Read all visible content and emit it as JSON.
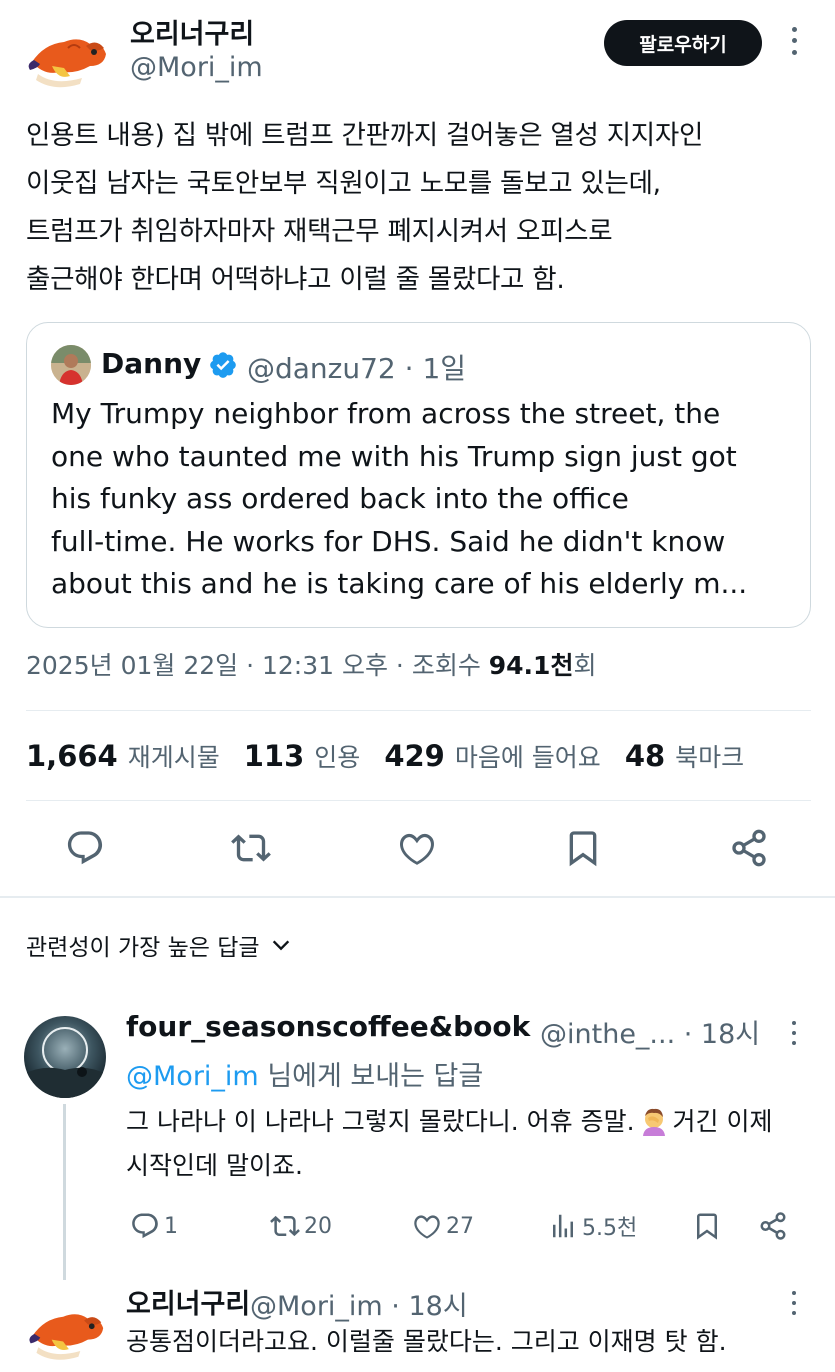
{
  "colors": {
    "text": "#0f1419",
    "secondary": "#536471",
    "link": "#1d9bf0",
    "border": "#cfd9de",
    "follow_bg": "#0f1419"
  },
  "author": {
    "display_name": "오리너구리",
    "handle": "@Mori_im",
    "avatar_icon": "duck-avatar-icon"
  },
  "follow_label": "팔로우하기",
  "tweet_lines": [
    "인용트 내용) 집 밖에 트럼프 간판까지 걸어놓은 열성 지지자인",
    "이웃집 남자는 국토안보부 직원이고 노모를 돌보고 있는데,",
    "트럼프가 취임하자마자 재택근무 폐지시켜서 오피스로",
    "출근해야 한다며 어떡하냐고 이럴 줄 몰랐다고 함."
  ],
  "quote": {
    "name": "Danny",
    "handle_time": "@danzu72 · 1일",
    "lines": [
      "My Trumpy neighbor from across the street, the",
      "one who taunted me with his Trump sign just got",
      "his funky ass ordered back into the office",
      "full-time. He works for DHS. Said he didn't know",
      "about this and he is taking care of his elderly m..."
    ]
  },
  "meta": {
    "datetime": "2025년 01월 22일 · 12:31 오후 · 조회수 ",
    "views": "94.1천",
    "views_suffix": "회"
  },
  "stats": [
    {
      "value": "1,664",
      "label": "재게시물"
    },
    {
      "value": "113",
      "label": "인용"
    },
    {
      "value": "429",
      "label": "마음에 들어요"
    },
    {
      "value": "48",
      "label": "북마크"
    }
  ],
  "sort_label": "관련성이 가장 높은 답글",
  "replies": [
    {
      "name": "four_seasonscoffee&book",
      "handle_time": "@inthe_... · 18시",
      "reply_to_mention": "@Mori_im",
      "reply_to_suffix": " 님에게 보내는 답글",
      "line1_a": "그 나라나 이 나라나 그렇지 몰랐다니. 어휴 증말.",
      "line1_b": "거긴 이제",
      "line2": "시작인데 말이죠.",
      "emoji": "facepalm-emoji",
      "counts": {
        "replies": "1",
        "reposts": "20",
        "likes": "27",
        "views": "5.5천"
      }
    },
    {
      "name": "오리너구리",
      "handle_time": "@Mori_im · 18시",
      "text": "공통점이더라고요. 이럴줄 몰랐다는. 그리고 이재명 탓 함."
    }
  ]
}
